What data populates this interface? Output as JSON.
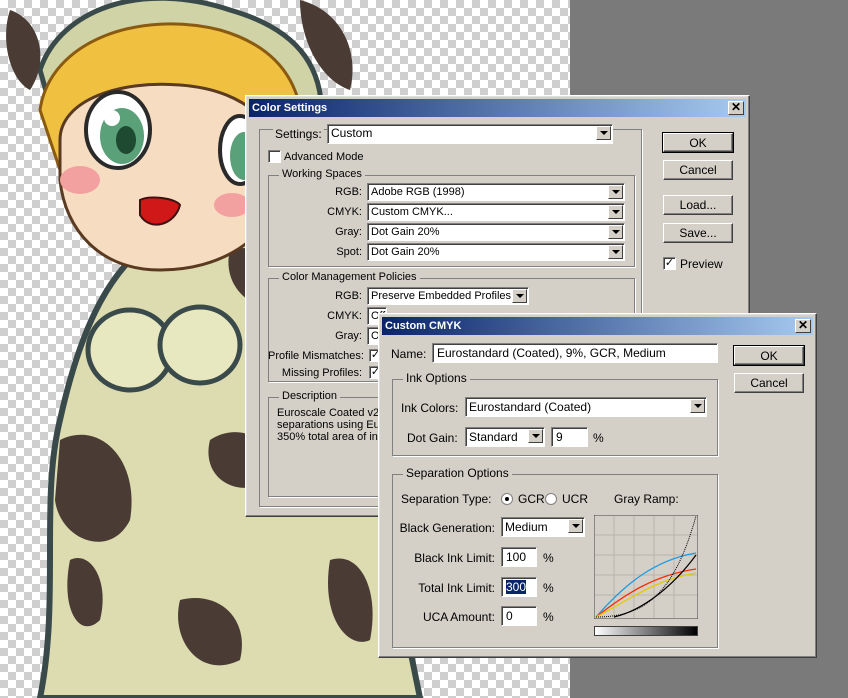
{
  "colors": {
    "title_start": "#0a246a",
    "title_end": "#a6caf0",
    "dialog_bg": "#d4d0c8",
    "workspace": "#7a7a7a"
  },
  "artwork": {
    "icon": "anime-girl-artwork"
  },
  "color_settings": {
    "title": "Color Settings",
    "close_symbol": "✕",
    "settings_label": "Settings:",
    "settings_value": "Custom",
    "advanced_mode": "Advanced Mode",
    "working_spaces": {
      "legend": "Working Spaces",
      "rgb_label": "RGB:",
      "rgb_value": "Adobe RGB (1998)",
      "cmyk_label": "CMYK:",
      "cmyk_value": "Custom CMYK...",
      "gray_label": "Gray:",
      "gray_value": "Dot Gain 20%",
      "spot_label": "Spot:",
      "spot_value": "Dot Gain 20%"
    },
    "policies": {
      "legend": "Color Management Policies",
      "rgb_label": "RGB:",
      "rgb_value": "Preserve Embedded Profiles",
      "cmyk_label": "CMYK:",
      "cmyk_value": "Off",
      "gray_label": "Gray:",
      "gray_value": "O",
      "mismatch_label": "Profile Mismatches:",
      "missing_label": "Missing Profiles:"
    },
    "description": {
      "legend": "Description",
      "line1": "Euroscale Coated v2:",
      "line2": "separations using Euro",
      "line3": "350% total area of ink"
    },
    "buttons": {
      "ok": "OK",
      "cancel": "Cancel",
      "load": "Load...",
      "save": "Save..."
    },
    "preview": "Preview"
  },
  "custom_cmyk": {
    "title": "Custom CMYK",
    "close_symbol": "✕",
    "name_label": "Name:",
    "name_value": "Eurostandard (Coated), 9%, GCR, Medium",
    "ok": "OK",
    "cancel": "Cancel",
    "ink_options": {
      "legend": "Ink Options",
      "ink_colors_label": "Ink Colors:",
      "ink_colors_value": "Eurostandard (Coated)",
      "dot_gain_label": "Dot Gain:",
      "dot_gain_mode": "Standard",
      "dot_gain_value": "9",
      "percent": "%"
    },
    "separation_options": {
      "legend": "Separation Options",
      "type_label": "Separation Type:",
      "gcr": "GCR",
      "ucr": "UCR",
      "gray_ramp_label": "Gray Ramp:",
      "black_gen_label": "Black Generation:",
      "black_gen_value": "Medium",
      "black_ink_label": "Black Ink Limit:",
      "black_ink_value": "100",
      "total_ink_label": "Total Ink Limit:",
      "total_ink_value": "300",
      "uca_label": "UCA Amount:",
      "uca_value": "0",
      "percent": "%"
    }
  }
}
